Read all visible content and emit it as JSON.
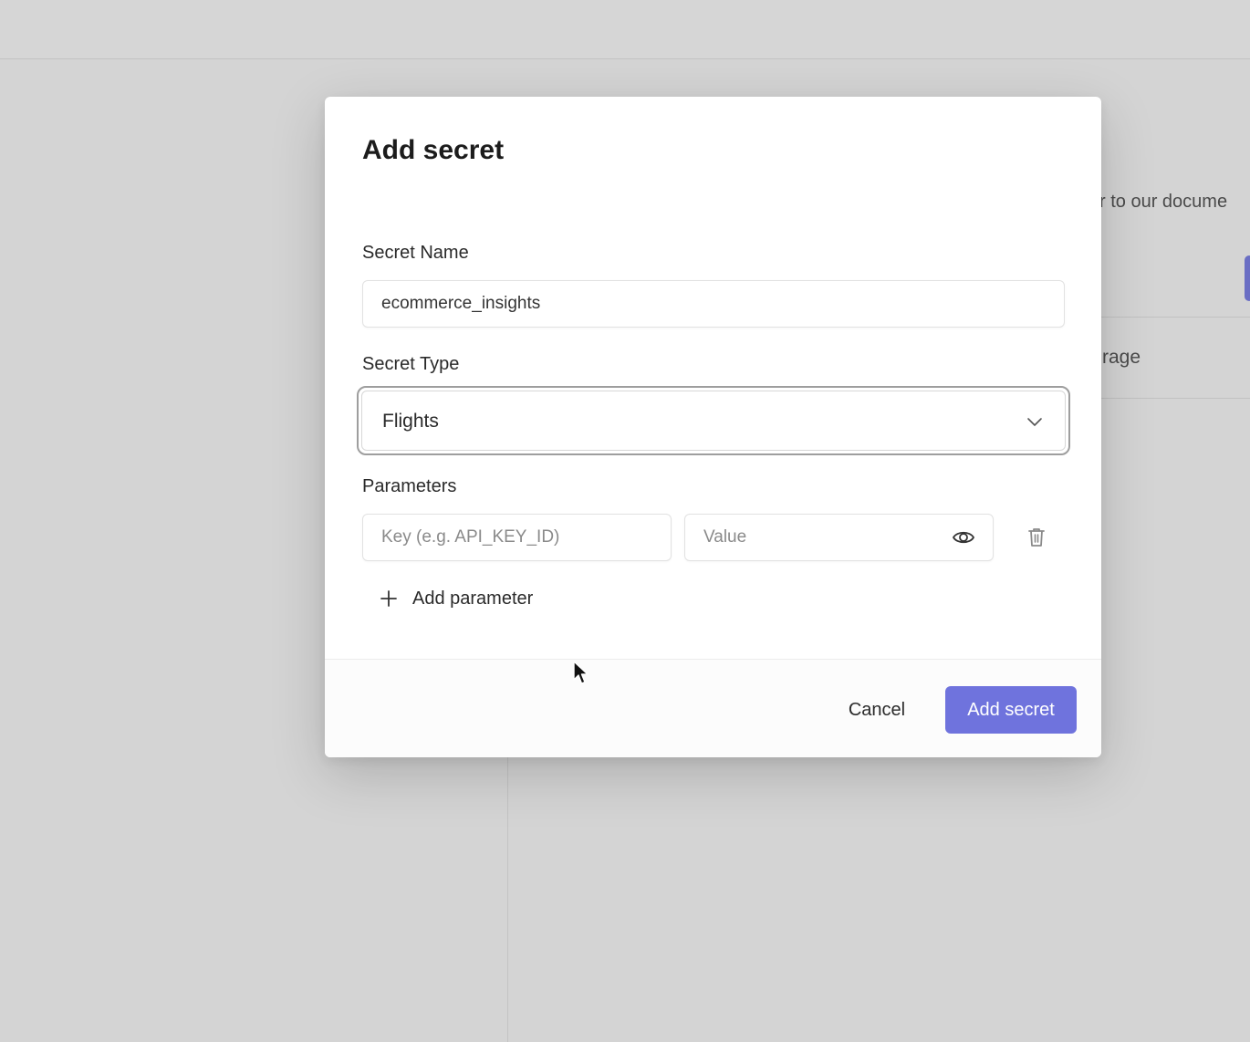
{
  "background": {
    "doc_text": "r to our docume",
    "storage_text": "rage"
  },
  "modal": {
    "title": "Add secret",
    "secret_name": {
      "label": "Secret Name",
      "value": "ecommerce_insights"
    },
    "secret_type": {
      "label": "Secret Type",
      "selected": "Flights"
    },
    "parameters": {
      "label": "Parameters",
      "key_placeholder": "Key (e.g. API_KEY_ID)",
      "value_placeholder": "Value",
      "add_label": "Add parameter"
    },
    "footer": {
      "cancel_label": "Cancel",
      "submit_label": "Add secret"
    }
  },
  "colors": {
    "accent": "#6f73dd",
    "overlay": "#d4d4d4"
  },
  "icons": {
    "select": "chevron-down-icon",
    "reveal": "eye-icon",
    "delete": "trash-icon",
    "add": "plus-icon",
    "pointer": "cursor-icon"
  }
}
